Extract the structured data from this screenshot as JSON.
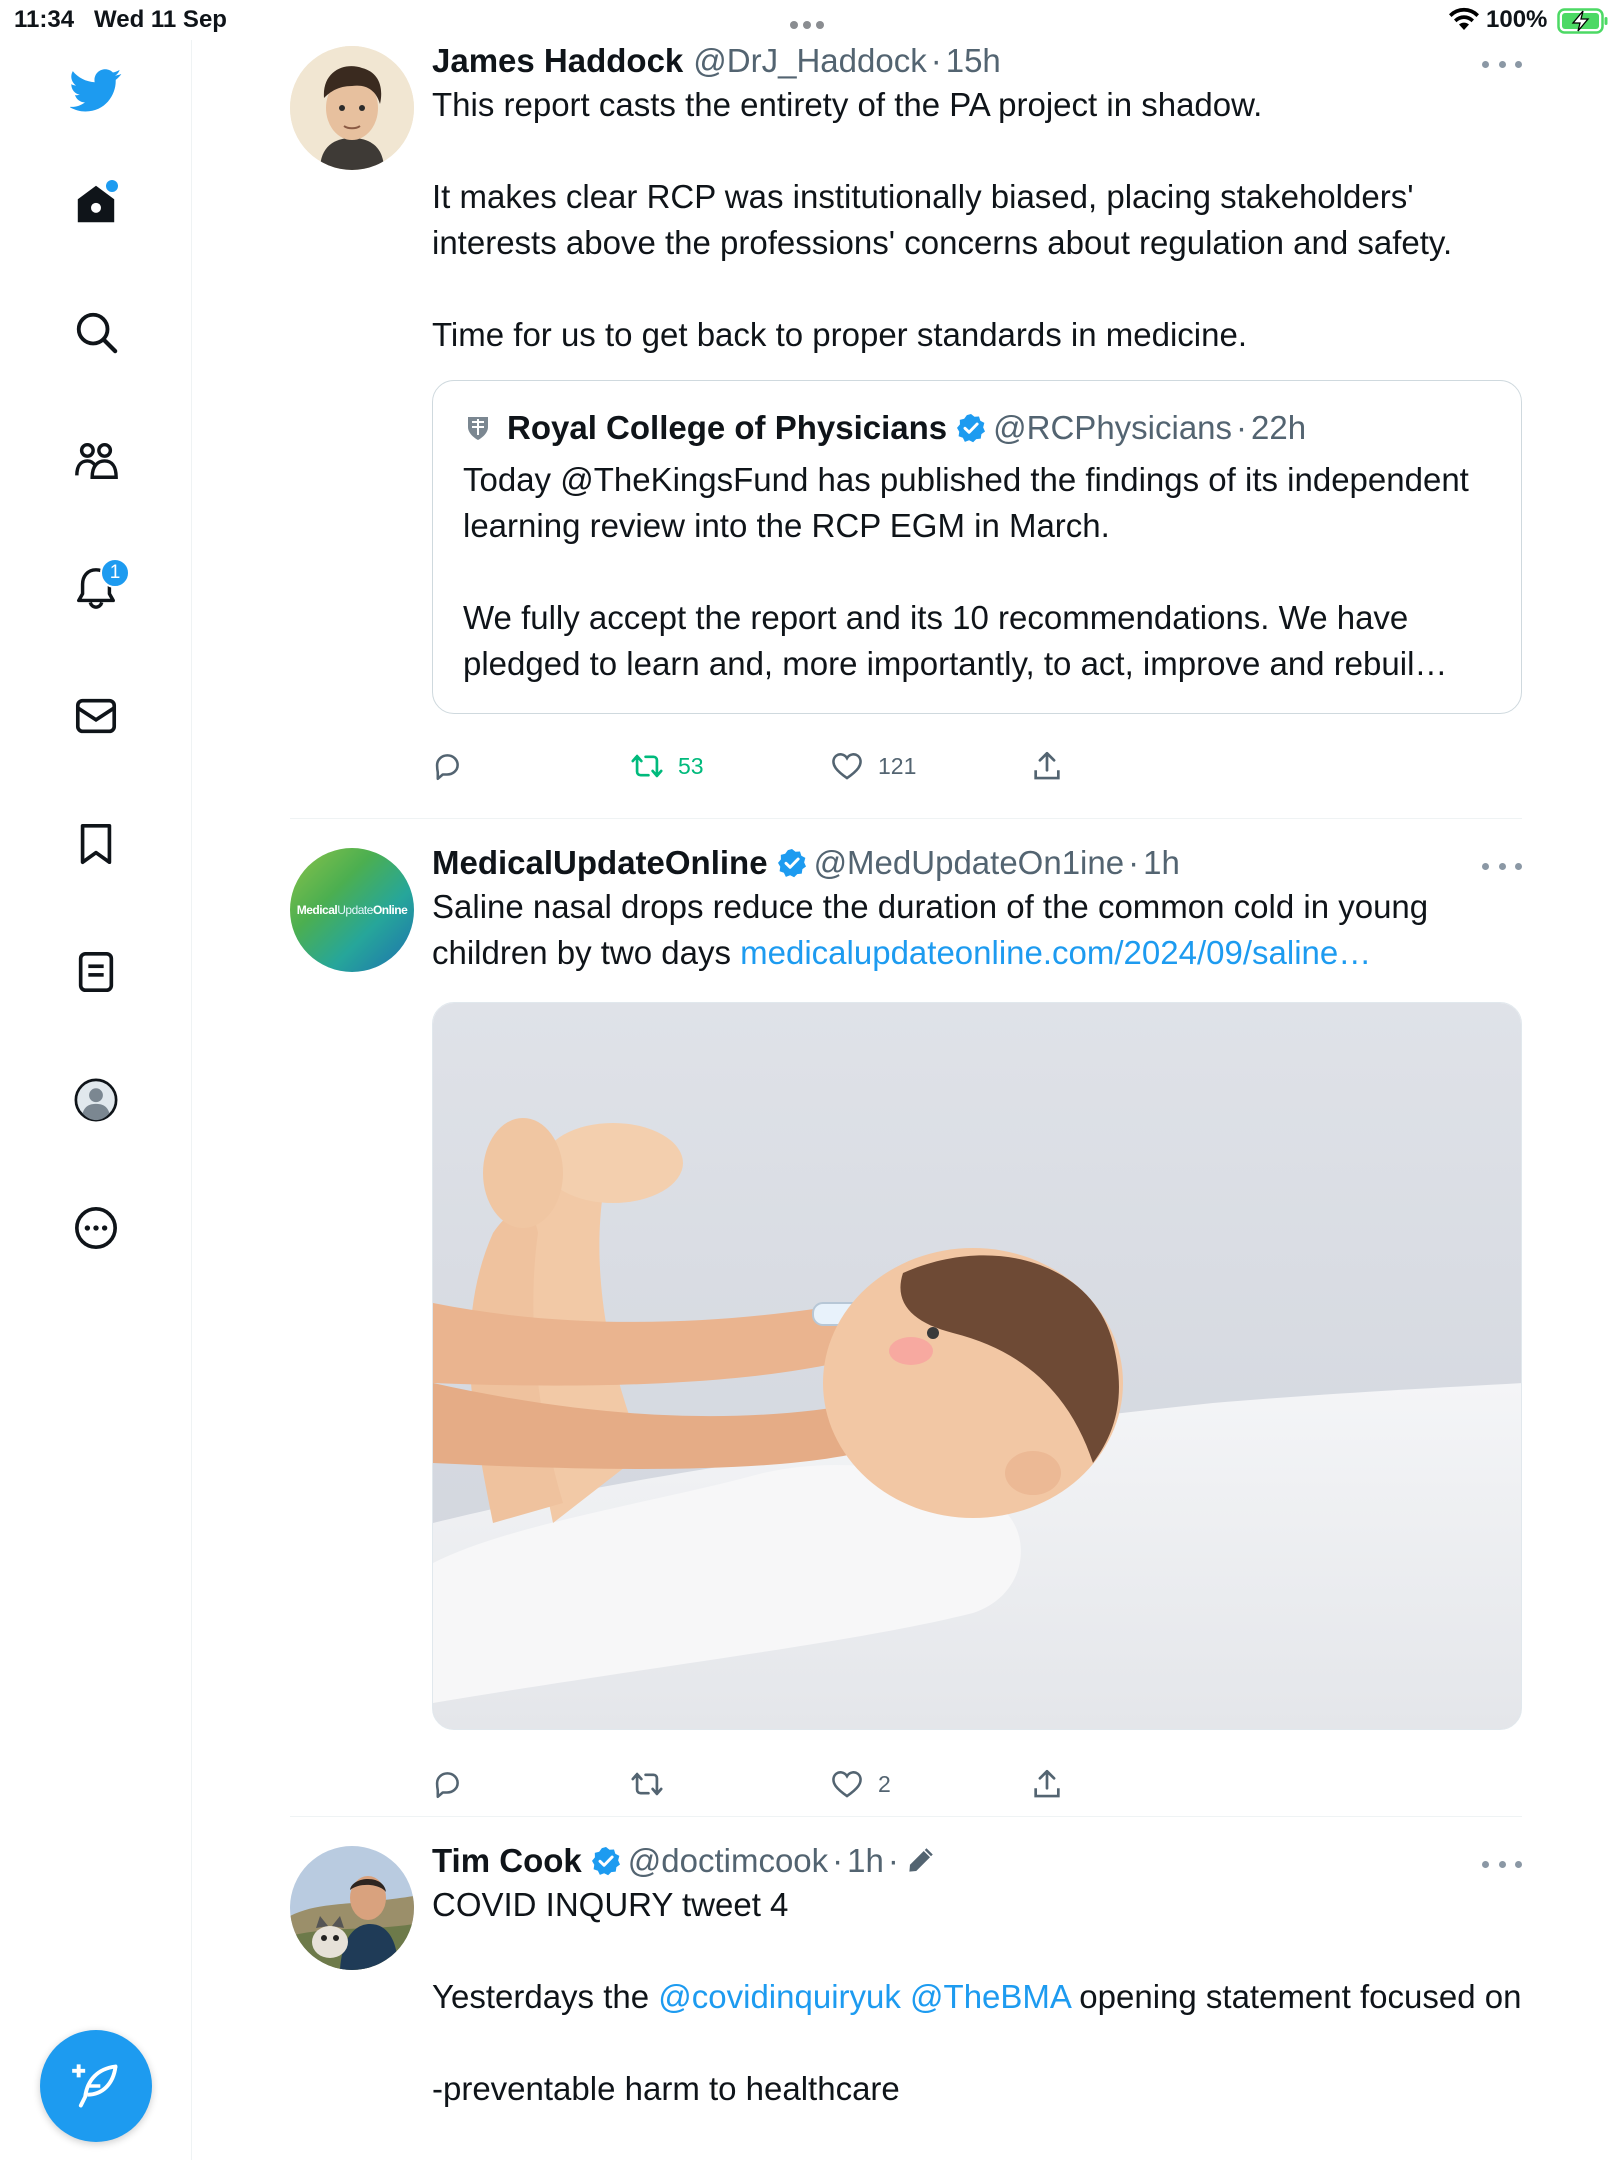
{
  "status_bar": {
    "time": "11:34",
    "date": "Wed 11 Sep",
    "battery": "100%"
  },
  "sidebar": {
    "items": [
      {
        "name": "twitter-logo-icon"
      },
      {
        "name": "home-icon"
      },
      {
        "name": "search-icon"
      },
      {
        "name": "communities-icon"
      },
      {
        "name": "notifications-icon",
        "badge": "1"
      },
      {
        "name": "messages-icon"
      },
      {
        "name": "bookmarks-icon"
      },
      {
        "name": "lists-icon"
      },
      {
        "name": "profile-icon"
      },
      {
        "name": "more-icon"
      }
    ],
    "compose": "compose-icon"
  },
  "colors": {
    "accent": "#1d9bf0",
    "retweet_green": "#00ba7c",
    "muted": "#536471"
  },
  "tweets": [
    {
      "name": "James Haddock",
      "handle": "@DrJ_Haddock",
      "sep": "·",
      "time": "15h",
      "text": "This report casts the entirety of the PA project in shadow.\n\nIt makes clear RCP was institutionally biased, placing stakeholders' interests above the professions' concerns about regulation and safety.\n\nTime for us to get back to proper standards in medicine.",
      "quote": {
        "name": "Royal College of Physicians",
        "handle": "@RCPhysicians",
        "sep": "·",
        "time": "22h",
        "text": "Today @TheKingsFund has published the findings of its independent learning review into the RCP EGM in March.\n\nWe fully accept the report and its 10 recommendations. We have pledged to learn and, more importantly, to act, improve and rebuil…"
      },
      "retweets": "53",
      "likes": "121"
    },
    {
      "name": "MedicalUpdateOnline",
      "handle": "@MedUpdateOn1ine",
      "sep": "·",
      "time": "1h",
      "text": "Saline nasal drops reduce the duration of the common cold in young children by two days ",
      "link": "medicalupdateonline.com/2024/09/saline…",
      "avatar_text_a": "Medical",
      "avatar_text_b": "Update",
      "avatar_text_c": "Online",
      "likes": "2"
    },
    {
      "name": "Tim Cook",
      "handle": "@doctimcook",
      "sep": "·",
      "time": "1h",
      "sep2": "·",
      "text_a": "COVID INQURY tweet 4\n\nYesterdays the ",
      "mention_1": "@covidinquiryuk",
      "space": " ",
      "mention_2": "@TheBMA",
      "text_b": " opening statement focused on\n\n-preventable harm to healthcare"
    }
  ]
}
